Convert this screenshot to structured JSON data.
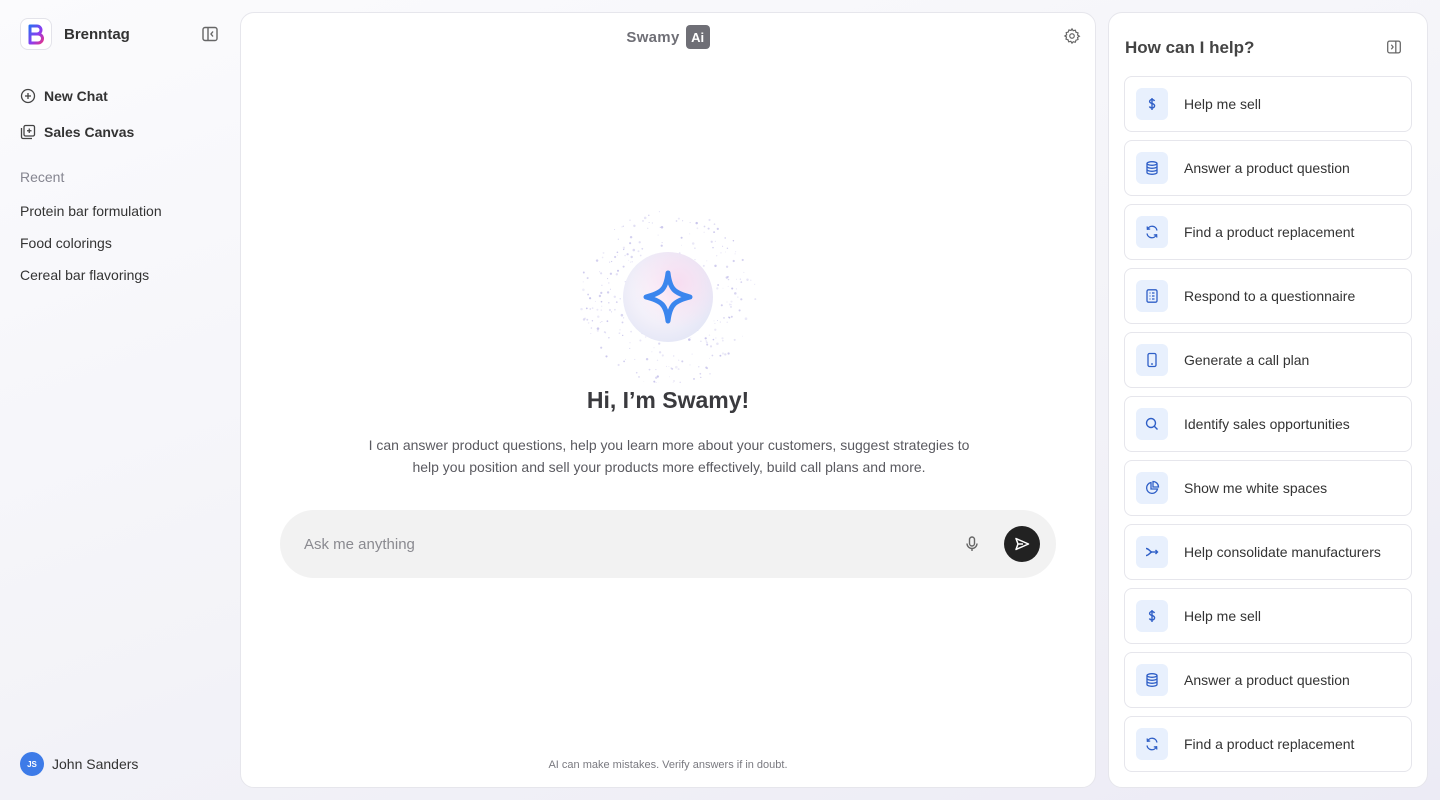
{
  "brand": {
    "name": "Brenntag",
    "logo_letter": "B"
  },
  "nav": {
    "new_chat": "New Chat",
    "sales_canvas": "Sales Canvas"
  },
  "recent": {
    "title": "Recent",
    "items": [
      "Protein bar formulation",
      "Food colorings",
      "Cereal bar flavorings"
    ]
  },
  "user": {
    "initials": "JS",
    "name": "John Sanders"
  },
  "header": {
    "product_name": "Swamy",
    "badge": "Ai"
  },
  "hero": {
    "greeting": "Hi, I’m Swamy!",
    "intro": "I can answer product questions, help you learn more about your customers, suggest strategies to help you position and sell your products more effectively, build call plans and more."
  },
  "chat": {
    "placeholder": "Ask me anything"
  },
  "disclaimer": "AI can make mistakes. Verify answers if in doubt.",
  "help_panel": {
    "title": "How can I help?",
    "actions": [
      {
        "label": "Help me sell",
        "icon": "dollar-icon"
      },
      {
        "label": "Answer a product question",
        "icon": "database-icon"
      },
      {
        "label": "Find a product replacement",
        "icon": "refresh-icon"
      },
      {
        "label": "Respond to a questionnaire",
        "icon": "list-icon"
      },
      {
        "label": "Generate a call plan",
        "icon": "phone-icon"
      },
      {
        "label": "Identify sales opportunities",
        "icon": "search-icon"
      },
      {
        "label": "Show me white spaces",
        "icon": "pie-icon"
      },
      {
        "label": "Help consolidate manufacturers",
        "icon": "merge-icon"
      },
      {
        "label": "Help me sell",
        "icon": "dollar-icon"
      },
      {
        "label": "Answer a product question",
        "icon": "database-icon"
      },
      {
        "label": "Find a product replacement",
        "icon": "refresh-icon"
      }
    ]
  },
  "colors": {
    "accent": "#3d7be8",
    "icon_bg": "#e8f0fd",
    "icon_fg": "#2f5fc7",
    "send_bg": "#222222"
  }
}
